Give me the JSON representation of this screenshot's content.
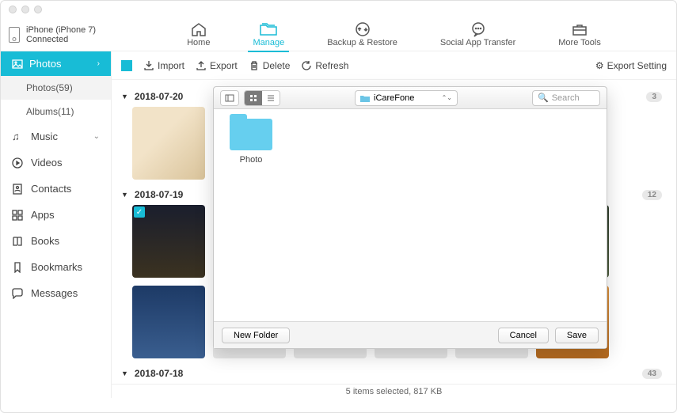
{
  "device": {
    "name": "iPhone (iPhone 7)",
    "status": "Connected"
  },
  "nav": {
    "home": "Home",
    "manage": "Manage",
    "backup": "Backup & Restore",
    "social": "Social App Transfer",
    "tools": "More Tools"
  },
  "sidebar": {
    "photos_header": "Photos",
    "photos_sub": "Photos(59)",
    "albums_sub": "Albums(11)",
    "music": "Music",
    "videos": "Videos",
    "contacts": "Contacts",
    "apps": "Apps",
    "books": "Books",
    "bookmarks": "Bookmarks",
    "messages": "Messages"
  },
  "toolbar": {
    "import": "Import",
    "export": "Export",
    "delete": "Delete",
    "refresh": "Refresh",
    "setting": "Export Setting"
  },
  "groups": [
    {
      "date": "2018-07-20",
      "count": "3"
    },
    {
      "date": "2018-07-19",
      "count": "12"
    },
    {
      "date": "2018-07-18",
      "count": "43"
    }
  ],
  "dialog": {
    "location": "iCareFone",
    "search_ph": "Search",
    "folder": "Photo",
    "new_folder": "New Folder",
    "cancel": "Cancel",
    "save": "Save"
  },
  "status": "5 items selected, 817 KB"
}
